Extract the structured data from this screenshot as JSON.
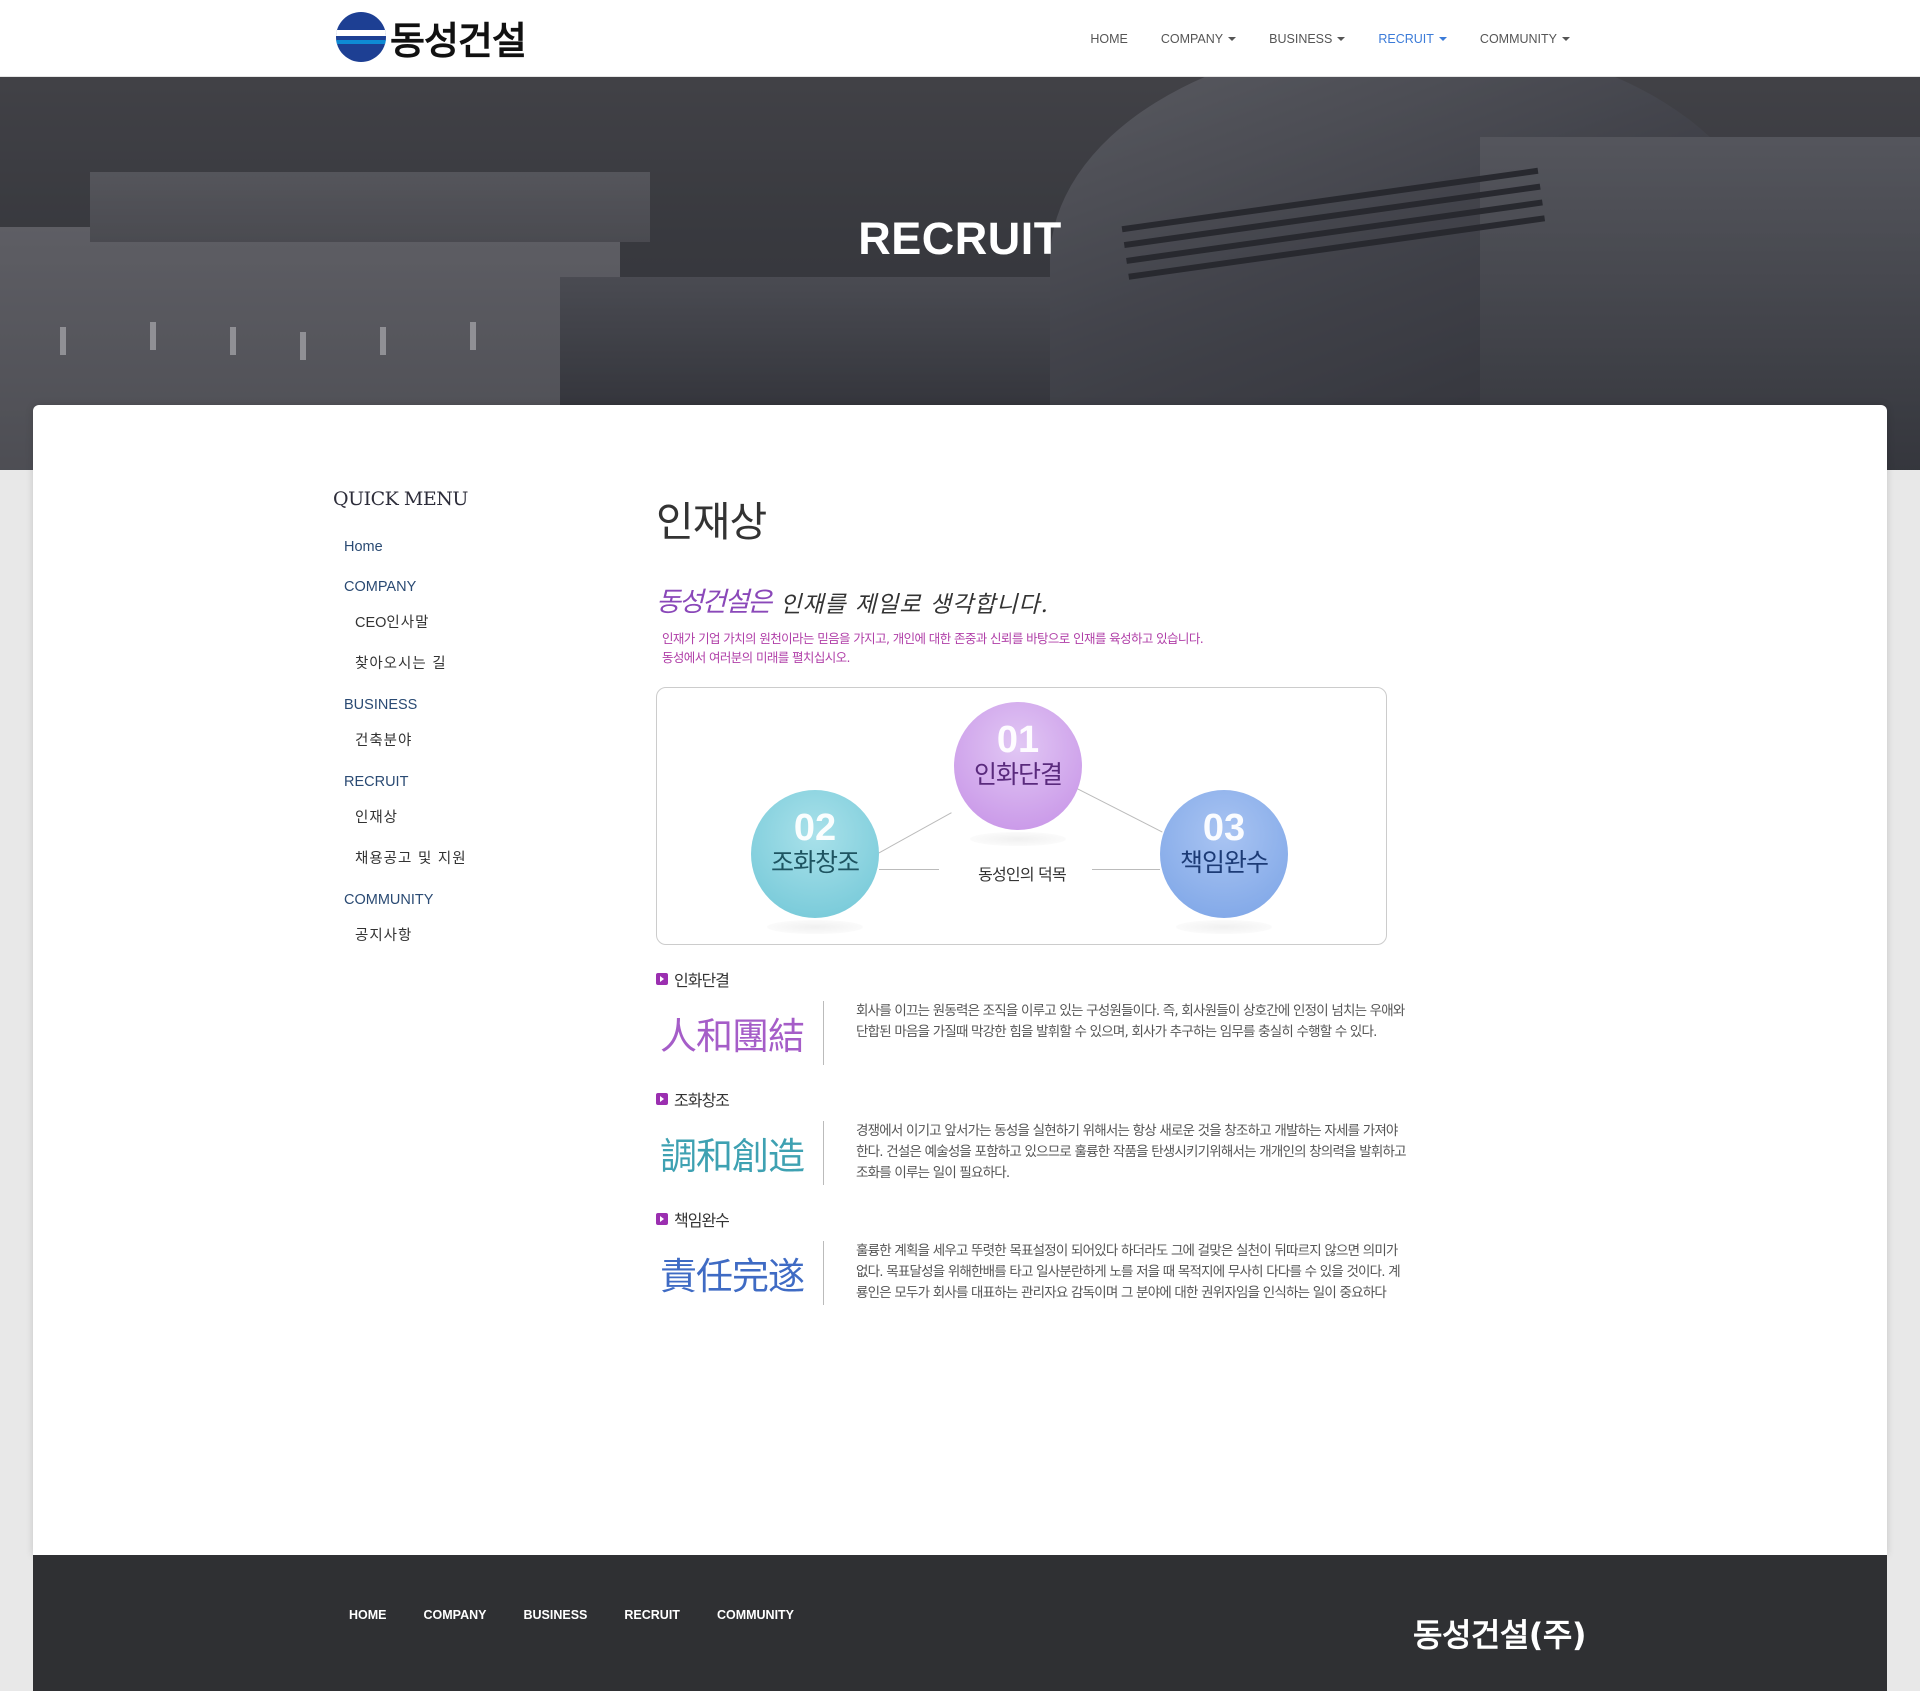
{
  "brand": {
    "logo_text": "동성건설"
  },
  "nav": {
    "items": [
      {
        "label": "HOME",
        "dropdown": false,
        "active": false
      },
      {
        "label": "COMPANY",
        "dropdown": true,
        "active": false
      },
      {
        "label": "BUSINESS",
        "dropdown": true,
        "active": false
      },
      {
        "label": "RECRUIT",
        "dropdown": true,
        "active": true
      },
      {
        "label": "COMMUNITY",
        "dropdown": true,
        "active": false
      }
    ],
    "active_color": "#3b7bd8"
  },
  "hero": {
    "title": "RECRUIT"
  },
  "sidebar": {
    "title": "QUICK MENU",
    "home": "Home",
    "company": "COMPANY",
    "company_ceo_prefix": "CEO",
    "company_ceo": "인사말",
    "company_map": "찾아오시는 길",
    "business": "BUSINESS",
    "business_arch": "건축분야",
    "recruit": "RECRUIT",
    "recruit_talent": "인재상",
    "recruit_jobs": "채용공고 및 지원",
    "community": "COMMUNITY",
    "community_notice": "공지사항"
  },
  "main": {
    "title": "인재상",
    "lead_company": "동성건설은",
    "lead_handwriting": "인재를 제일로 생각합니다.",
    "lead_desc_1": "인재가 기업 가치의 원천이라는 믿음을 가지고, 개인에 대한 존중과 신뢰를 바탕으로 인재를 육성하고 있습니다.",
    "lead_desc_2": "동성에서 여러분의 미래를 펼치십시오.",
    "diagram": {
      "center": "동성인의 덕목",
      "items": [
        {
          "num": "01",
          "name": "인화단결",
          "color": "#c58fe6"
        },
        {
          "num": "02",
          "name": "조화창조",
          "color": "#6fc6d6"
        },
        {
          "num": "03",
          "name": "책임완수",
          "color": "#7aa3e6"
        }
      ]
    },
    "sections": [
      {
        "title": "인화단결",
        "hanja": "人和團結",
        "text": "회사를 이끄는 원동력은 조직을 이루고 있는 구성원들이다. 즉, 회사원들이 상호간에 인정이 넘치는 우애와 단합된 마음을 가질때 막강한 힘을 발휘할 수 있으며, 회사가 추구하는 임무를 충실히 수행할 수 있다."
      },
      {
        "title": "조화창조",
        "hanja": "調和創造",
        "text": "경쟁에서 이기고 앞서가는 동성을 실현하기 위해서는 항상 새로운 것을 창조하고 개발하는 자세를 가져야 한다. 건설은 예술성을 포함하고 있으므로 훌륭한 작품을 탄생시키기위해서는 개개인의 창의력을 발휘하고 조화를 이루는 일이 필요하다."
      },
      {
        "title": "책임완수",
        "hanja": "責任完遂",
        "text": "훌륭한 계획을 세우고 뚜렷한 목표설정이 되어있다 하더라도 그에 걸맞은 실천이 뒤따르지 않으면 의미가 없다. 목표달성을 위해한배를 타고 일사분란하게 노를 저을 때 목적지에 무사히 다다를 수 있을 것이다. 계룡인은 모두가 회사를 대표하는 관리자요 감독이며 그 분야에 대한 권위자임을 인식하는 일이 중요하다"
      }
    ]
  },
  "footer": {
    "links": [
      "HOME",
      "COMPANY",
      "BUSINESS",
      "RECRUIT",
      "COMMUNITY"
    ],
    "brand": "동성건설(주)"
  }
}
